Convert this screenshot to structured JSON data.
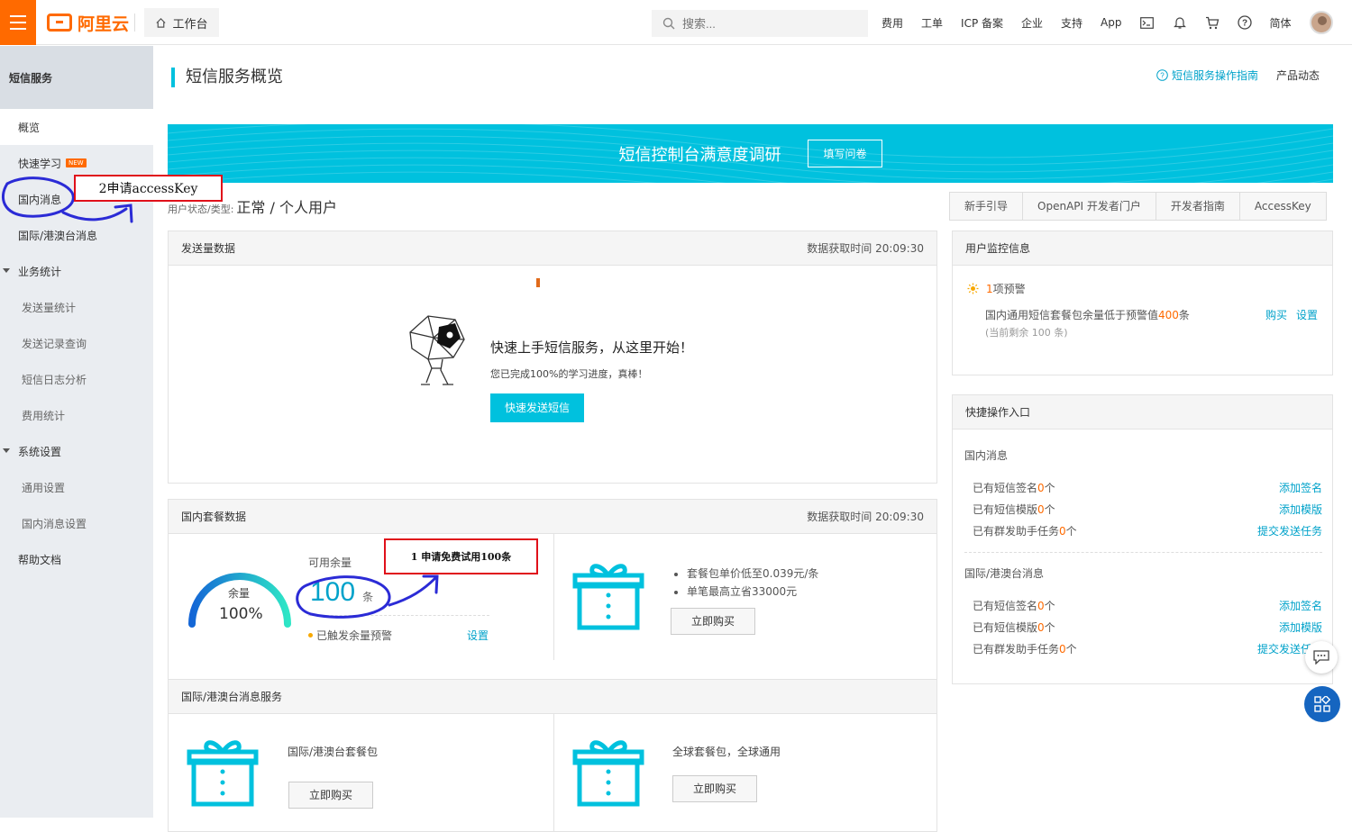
{
  "topbar": {
    "logo_text": "阿里云",
    "workbench": "工作台",
    "search_placeholder": "搜索...",
    "nav": [
      "费用",
      "工单",
      "ICP 备案",
      "企业",
      "支持",
      "App"
    ],
    "lang": "简体"
  },
  "sidebar": {
    "title": "短信服务",
    "items": [
      {
        "label": "概览"
      },
      {
        "label": "快速学习",
        "badge": "NEW"
      },
      {
        "label": "国内消息"
      },
      {
        "label": "国际/港澳台消息"
      },
      {
        "label": "业务统计"
      },
      {
        "label": "发送量统计"
      },
      {
        "label": "发送记录查询"
      },
      {
        "label": "短信日志分析"
      },
      {
        "label": "费用统计"
      },
      {
        "label": "系统设置"
      },
      {
        "label": "通用设置"
      },
      {
        "label": "国内消息设置"
      },
      {
        "label": "帮助文档"
      }
    ]
  },
  "page": {
    "title": "短信服务概览",
    "guide_link": "短信服务操作指南",
    "news_link": "产品动态",
    "banner_title": "短信控制台满意度调研",
    "banner_button": "填写问卷",
    "status_label": "用户状态/类型:",
    "status_value": "正常 / 个人用户",
    "tabs": [
      "新手引导",
      "OpenAPI 开发者门户",
      "开发者指南",
      "AccessKey"
    ]
  },
  "send_panel": {
    "title": "发送量数据",
    "time": "数据获取时间 20:09:30",
    "headline": "快速上手短信服务，从这里开始！",
    "sub": "您已完成100%的学习进度，真棒！",
    "button": "快速发送短信"
  },
  "package_panel": {
    "title": "国内套餐数据",
    "time": "数据获取时间 20:09:30",
    "gauge_label": "余量",
    "gauge_value": "100%",
    "gauge_fraction": 1.0,
    "available_label": "可用余量",
    "available_value": "100",
    "available_unit": "条",
    "warn_text": "已触发余量预警",
    "warn_link": "设置",
    "bullets": [
      "套餐包单价低至0.039元/条",
      "单笔最高立省33000元"
    ],
    "buy_button": "立即购买"
  },
  "intl_panel": {
    "title": "国际/港澳台消息服务",
    "left_text": "国际/港澳台套餐包",
    "left_button": "立即购买",
    "right_text": "全球套餐包，全球通用",
    "right_button": "立即购买"
  },
  "monitor_panel": {
    "title": "用户监控信息",
    "alert_count_pre": "1",
    "alert_count_post": "项预警",
    "msg_pre": "国内通用短信套餐包余量低于预警值",
    "msg_value": "400",
    "msg_post": "条",
    "remaining": "(当前剩余 100 条)",
    "buy": "购买",
    "setting": "设置"
  },
  "quick_panel": {
    "title": "快捷操作入口",
    "domestic": {
      "label": "国内消息",
      "rows": [
        {
          "text": "已有短信签名",
          "value": "0",
          "unit": "个",
          "action": "添加签名"
        },
        {
          "text": "已有短信模版",
          "value": "0",
          "unit": "个",
          "action": "添加模版"
        },
        {
          "text": "已有群发助手任务",
          "value": "0",
          "unit": "个",
          "action": "提交发送任务"
        }
      ]
    },
    "intl": {
      "label": "国际/港澳台消息",
      "rows": [
        {
          "text": "已有短信签名",
          "value": "0",
          "unit": "个",
          "action": "添加签名"
        },
        {
          "text": "已有短信模版",
          "value": "0",
          "unit": "个",
          "action": "添加模版"
        },
        {
          "text": "已有群发助手任务",
          "value": "0",
          "unit": "个",
          "action": "提交发送任务"
        }
      ]
    }
  },
  "annotations": {
    "note1": "1 申请免费试用100条",
    "note2": "2申请accessKey"
  },
  "colors": {
    "accent": "#00c1de",
    "brand": "#ff6a00",
    "annotation_pen": "#2b2bd6",
    "annotation_box": "#e0101a"
  }
}
